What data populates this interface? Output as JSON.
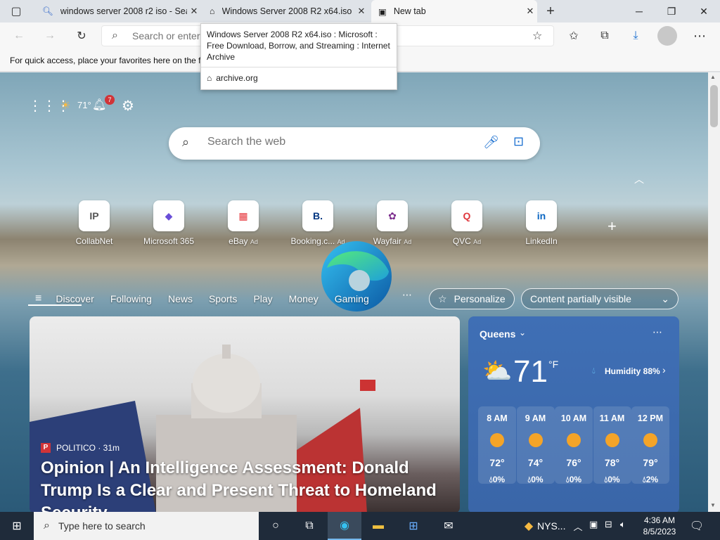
{
  "tabs": [
    {
      "title": "windows server 2008 r2 iso - Sea"
    },
    {
      "title": "Windows Server 2008 R2 x64.iso"
    },
    {
      "title": "New tab"
    }
  ],
  "address": {
    "placeholder": "Search or enter"
  },
  "favorites_bar": {
    "text": "For quick access, place your favorites here on the f"
  },
  "tooltip": {
    "title": "Windows Server 2008 R2 x64.iso : Microsoft : Free Download, Borrow, and Streaming : Internet Archive",
    "domain": "archive.org"
  },
  "newtab": {
    "weather_temp": "71°",
    "notif_count": "7",
    "search_placeholder": "Search the web",
    "quick_links": [
      {
        "label": "CollabNet",
        "ad": "",
        "glyph": "IP",
        "color": "#555555"
      },
      {
        "label": "Microsoft 365",
        "ad": "",
        "glyph": "◆",
        "color": "#6a4fd8"
      },
      {
        "label": "eBay",
        "ad": "Ad",
        "glyph": "▦",
        "color": "#e53238"
      },
      {
        "label": "Booking.c...",
        "ad": "Ad",
        "glyph": "B.",
        "color": "#003580"
      },
      {
        "label": "Wayfair",
        "ad": "Ad",
        "glyph": "✿",
        "color": "#7b2c8c"
      },
      {
        "label": "QVC",
        "ad": "Ad",
        "glyph": "Q",
        "color": "#e0393e"
      },
      {
        "label": "LinkedIn",
        "ad": "",
        "glyph": "in",
        "color": "#0a66c2"
      }
    ],
    "nav": [
      "Discover",
      "Following",
      "News",
      "Sports",
      "Play",
      "Money",
      "Gaming"
    ],
    "personalize": "Personalize",
    "content_visibility": "Content partially visible",
    "hero": {
      "source": "POLITICO · 31m",
      "headline": "Opinion | An Intelligence Assessment: Donald Trump Is a Clear and Present Threat to Homeland Security"
    },
    "weather": {
      "city": "Queens",
      "temp": "71",
      "unit": "°F",
      "humidity": "Humidity 88%",
      "hours": [
        {
          "time": "8 AM",
          "temp": "72°",
          "precip": "0%"
        },
        {
          "time": "9 AM",
          "temp": "74°",
          "precip": "0%"
        },
        {
          "time": "10 AM",
          "temp": "76°",
          "precip": "0%"
        },
        {
          "time": "11 AM",
          "temp": "78°",
          "precip": "0%"
        },
        {
          "time": "12 PM",
          "temp": "79°",
          "precip": "2%"
        }
      ]
    }
  },
  "taskbar": {
    "search_placeholder": "Type here to search",
    "stock": "NYS...",
    "time": "4:36 AM",
    "date": "8/5/2023"
  }
}
